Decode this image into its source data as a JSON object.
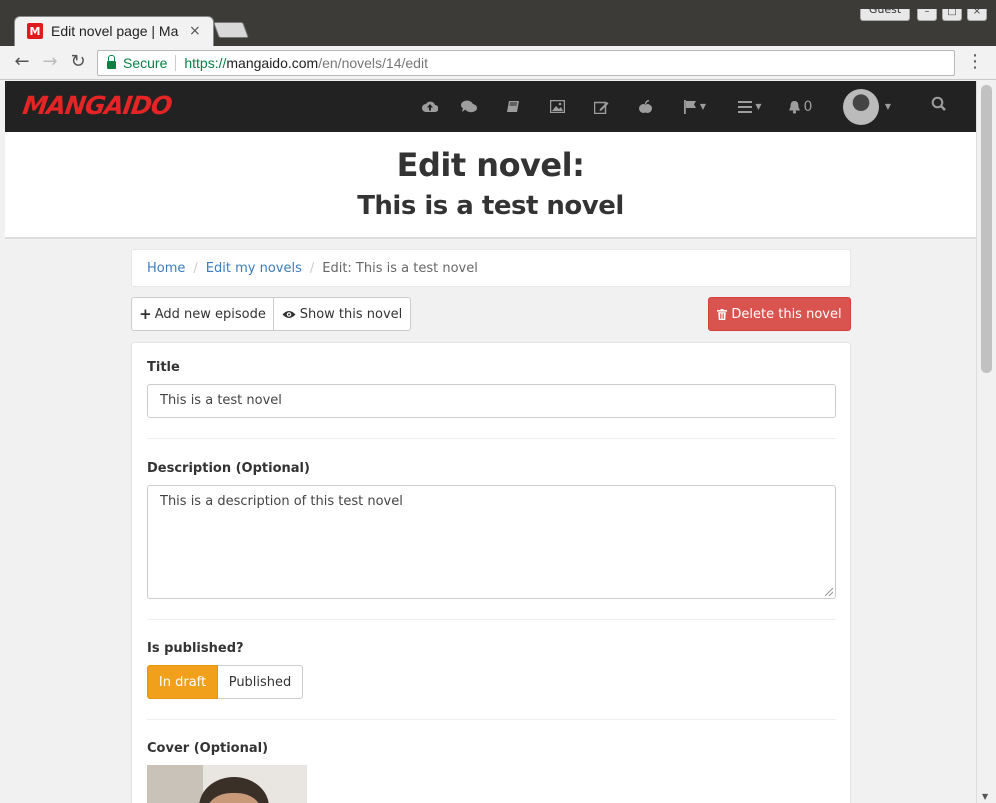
{
  "browser": {
    "tab_title": "Edit novel page | Ma",
    "tab_close": "×",
    "guest_label": "Guest",
    "secure_label": "Secure",
    "url_scheme": "https://",
    "url_host": "mangaido.com",
    "url_path": "/en/novels/14/edit",
    "back": "←",
    "forward": "→",
    "reload": "↻",
    "menu": "⋮",
    "win_min": "–",
    "win_max": "□",
    "win_close": "×"
  },
  "site": {
    "logo": "MANGAIDO",
    "notification_count": "0",
    "nav_icons": [
      "upload-icon",
      "comments-icon",
      "book-icon",
      "image-icon",
      "edit-icon",
      "apple-icon",
      "flag-icon",
      "menu-icon",
      "bell-icon",
      "search-icon"
    ]
  },
  "header": {
    "title": "Edit novel:",
    "subtitle": "This is a test novel"
  },
  "breadcrumb": {
    "home": "Home",
    "my_novels": "Edit my novels",
    "current": "Edit: This is a test novel"
  },
  "actions": {
    "add_episode": "Add new episode",
    "show_novel": "Show this novel",
    "delete_novel": "Delete this novel"
  },
  "form": {
    "title_label": "Title",
    "title_value": "This is a test novel",
    "description_label": "Description (Optional)",
    "description_value": "This is a description of this test novel",
    "published_label": "Is published?",
    "draft_option": "In draft",
    "published_option": "Published",
    "cover_label": "Cover (Optional)"
  },
  "colors": {
    "navbar": "#222222",
    "logo": "#e52525",
    "link": "#3b7dbf",
    "danger": "#d9534f",
    "draft_active": "#f0a01b"
  }
}
